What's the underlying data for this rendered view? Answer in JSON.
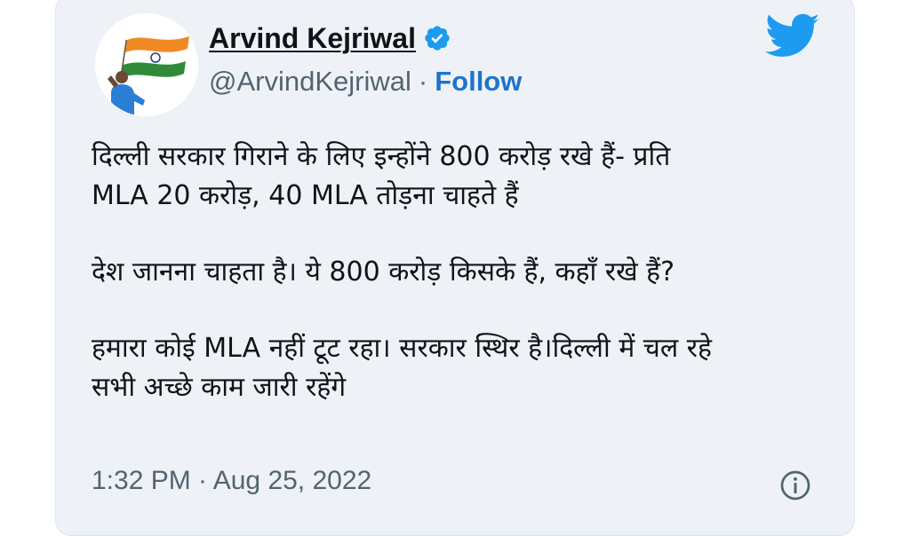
{
  "author": {
    "display_name": "Arvind Kejriwal",
    "handle": "@ArvindKejriwal",
    "separator": "·",
    "follow_label": "Follow",
    "verified_icon": "verified-badge-icon",
    "avatar_icon": "profile-avatar"
  },
  "brand": {
    "logo_icon": "twitter-bird-icon",
    "accent_color": "#1d9bf0"
  },
  "tweet": {
    "paragraphs": [
      {
        "lines": [
          "दिल्ली सरकार गिराने के लिए इन्होंने 800 करोड़ रखे हैं- प्रति",
          "MLA 20 करोड़, 40 MLA तोड़ना चाहते हैं"
        ]
      },
      {
        "lines": [
          "देश जानना चाहता है। ये 800 करोड़ किसके हैं, कहाँ रखे हैं?"
        ]
      },
      {
        "lines": [
          "हमारा कोई MLA नहीं टूट रहा। सरकार स्थिर है।दिल्ली में चल रहे",
          "सभी अच्छे काम जारी रहेंगे"
        ]
      }
    ]
  },
  "footer": {
    "timestamp": "1:32 PM · Aug 25, 2022",
    "info_icon": "info-icon"
  }
}
